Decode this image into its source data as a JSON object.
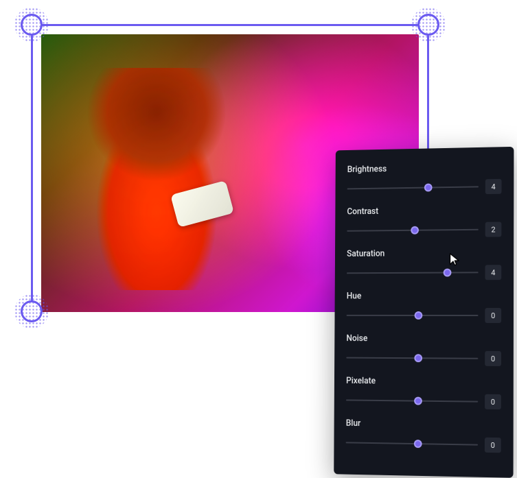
{
  "image": {
    "description": "photo-preview"
  },
  "sliders": [
    {
      "label": "Brightness",
      "value": "4",
      "percent": 62
    },
    {
      "label": "Contrast",
      "value": "2",
      "percent": 52
    },
    {
      "label": "Saturation",
      "value": "4",
      "percent": 77
    },
    {
      "label": "Hue",
      "value": "0",
      "percent": 55
    },
    {
      "label": "Noise",
      "value": "0",
      "percent": 55
    },
    {
      "label": "Pixelate",
      "value": "0",
      "percent": 55
    },
    {
      "label": "Blur",
      "value": "0",
      "percent": 55
    }
  ],
  "colors": {
    "accent": "#7b68ee",
    "frame": "#6b5af0",
    "panel_bg": "#13161f",
    "value_bg": "#242833"
  }
}
